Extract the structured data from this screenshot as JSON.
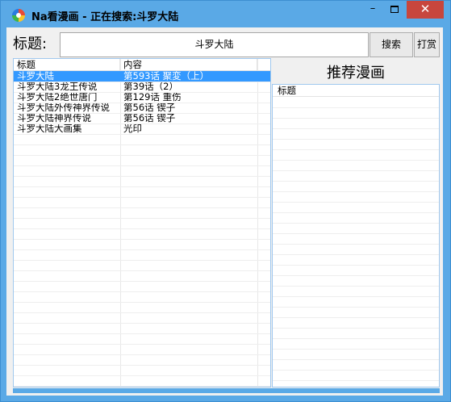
{
  "window": {
    "title": "Na看漫画 - 正在搜索:斗罗大陆",
    "minimize_label": "–",
    "close_label": "✕"
  },
  "search": {
    "label": "标题:",
    "value": "斗罗大陆",
    "search_button": "搜索",
    "donate_button": "打赏"
  },
  "results": {
    "columns": [
      "标题",
      "内容"
    ],
    "rows": [
      {
        "title": "斗罗大陆",
        "content": "第593话 聚変（上）",
        "selected": true
      },
      {
        "title": "斗罗大陆3龙王传说",
        "content": "第39话（2）",
        "selected": false
      },
      {
        "title": "斗罗大陆2绝世唐门",
        "content": "第129话 重伤",
        "selected": false
      },
      {
        "title": "斗罗大陆外传神界传说",
        "content": "第56话 锲子",
        "selected": false
      },
      {
        "title": "斗罗大陆神界传说",
        "content": "第56话 锲子",
        "selected": false
      },
      {
        "title": "斗罗大陆大画集",
        "content": "光印",
        "selected": false
      }
    ]
  },
  "recommend": {
    "title": "推荐漫画",
    "column": "标题"
  }
}
